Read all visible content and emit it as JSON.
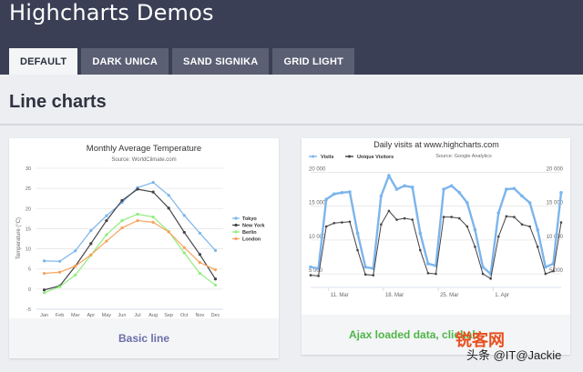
{
  "app": {
    "title": "Highcharts Demos"
  },
  "tabs": [
    {
      "label": "DEFAULT",
      "active": true
    },
    {
      "label": "DARK UNICA",
      "active": false
    },
    {
      "label": "SAND SIGNIKA",
      "active": false
    },
    {
      "label": "GRID LIGHT",
      "active": false
    }
  ],
  "section": {
    "title": "Line charts"
  },
  "cards": [
    {
      "footer": "Basic line"
    },
    {
      "footer": "Ajax loaded data, clickab"
    }
  ],
  "watermark": {
    "brand": "锐客网",
    "handle": "头条 @IT@Jackie"
  },
  "colors": {
    "topbar": "#3b3f55",
    "tokyo": "#7cb5ec",
    "new_york": "#434348",
    "berlin": "#90ed7d",
    "london": "#f7a35c"
  },
  "chart_data": [
    {
      "type": "line",
      "title": "Monthly Average Temperature",
      "subtitle": "Source: WorldClimate.com",
      "ylabel": "Temperature (°C)",
      "xlabel": "",
      "ylim": [
        -5,
        30
      ],
      "yticks": [
        "30",
        "25",
        "20",
        "15",
        "10",
        "5",
        "0",
        "-5"
      ],
      "categories": [
        "Jan",
        "Feb",
        "Mar",
        "Apr",
        "May",
        "Jun",
        "Jul",
        "Aug",
        "Sep",
        "Oct",
        "Nov",
        "Dec"
      ],
      "legend_position": "right",
      "series": [
        {
          "name": "Tokyo",
          "color": "#7cb5ec",
          "values": [
            7.0,
            6.9,
            9.5,
            14.5,
            18.2,
            21.5,
            25.2,
            26.5,
            23.3,
            18.3,
            13.9,
            9.6
          ]
        },
        {
          "name": "New York",
          "color": "#434348",
          "values": [
            -0.2,
            0.8,
            5.7,
            11.3,
            17.0,
            22.0,
            24.8,
            24.1,
            20.1,
            14.1,
            8.6,
            2.5
          ]
        },
        {
          "name": "Berlin",
          "color": "#90ed7d",
          "values": [
            -0.9,
            0.6,
            3.5,
            8.4,
            13.5,
            17.0,
            18.6,
            17.9,
            14.3,
            9.0,
            3.9,
            1.0
          ]
        },
        {
          "name": "London",
          "color": "#f7a35c",
          "values": [
            3.9,
            4.2,
            5.7,
            8.5,
            11.9,
            15.2,
            17.0,
            16.6,
            14.2,
            10.3,
            6.6,
            4.8
          ]
        }
      ]
    },
    {
      "type": "line",
      "title": "Daily visits at www.highcharts.com",
      "subtitle": "Source: Google Analytics",
      "ylim": [
        3000,
        21000
      ],
      "yticks": [
        "20 000",
        "15 000",
        "10 000",
        "5 000"
      ],
      "ytick_values": [
        20000,
        15000,
        10000,
        5000
      ],
      "x_ticks": [
        "11. Mar",
        "18. Mar",
        "25. Mar",
        "1. Apr"
      ],
      "legend_position": "top-left",
      "series": [
        {
          "name": "Visits",
          "color": "#7cb5ec",
          "values": [
            6000,
            5800,
            16000,
            16800,
            17000,
            17100,
            11000,
            6000,
            5800,
            16500,
            19500,
            17500,
            18000,
            17800,
            11000,
            6500,
            6200,
            17500,
            18000,
            17000,
            15500,
            11500,
            6000,
            5000,
            14000,
            17500,
            17600,
            16500,
            15500,
            11500,
            6000,
            6500,
            17000
          ]
        },
        {
          "name": "Unique Visitors",
          "color": "#434348",
          "values": [
            4800,
            4700,
            12000,
            12500,
            12600,
            12700,
            8500,
            4900,
            4800,
            12300,
            14300,
            13000,
            13200,
            13000,
            8500,
            5100,
            5000,
            13400,
            13400,
            13200,
            12000,
            9000,
            5000,
            4300,
            10500,
            13500,
            13400,
            12300,
            12000,
            9000,
            5000,
            5400,
            12600
          ]
        }
      ]
    }
  ]
}
